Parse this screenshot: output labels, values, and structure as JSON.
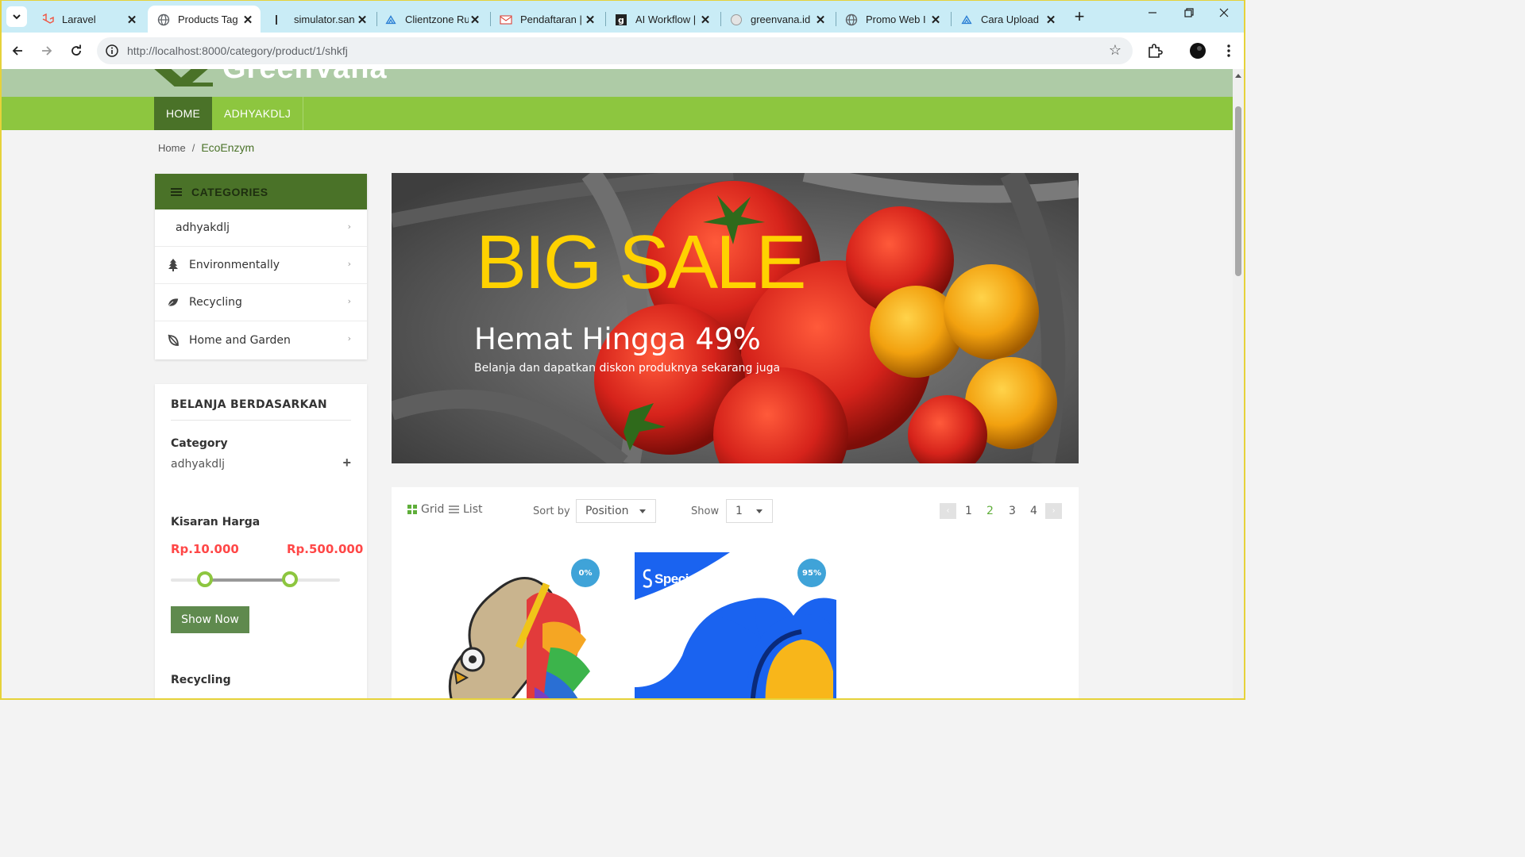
{
  "browser": {
    "tabs": [
      {
        "title": "Laravel",
        "icon": "laravel-icon",
        "active": false
      },
      {
        "title": "Products Tag",
        "icon": "globe-icon",
        "active": true
      },
      {
        "title": "simulator.san",
        "icon": "bar-icon",
        "active": false
      },
      {
        "title": "Clientzone Ru",
        "icon": "cloud-icon",
        "active": false
      },
      {
        "title": "Pendaftaran |",
        "icon": "mail-icon",
        "active": false
      },
      {
        "title": "AI Workflow |",
        "icon": "g-icon",
        "active": false
      },
      {
        "title": "greenvana.id",
        "icon": "globe-icon",
        "active": false
      },
      {
        "title": "Promo Web I",
        "icon": "globe-icon",
        "active": false
      },
      {
        "title": "Cara Upload",
        "icon": "cloud-icon",
        "active": false
      }
    ],
    "url_host": "http://localhost",
    "url_port": ":8000",
    "url_path": "/category/product/1/shkfj"
  },
  "site": {
    "logo_text": "GreenVana",
    "nav": [
      {
        "label": "HOME",
        "active": true
      },
      {
        "label": "ADHYAKDLJ",
        "active": false
      }
    ],
    "breadcrumb": {
      "home": "Home",
      "separator": "/",
      "current": "EcoEnzym"
    }
  },
  "sidebar": {
    "categories_title": "CATEGORIES",
    "categories": [
      {
        "label": "adhyakdlj",
        "icon": ""
      },
      {
        "label": "Environmentally",
        "icon": "tree-icon"
      },
      {
        "label": "Recycling",
        "icon": "leaf-icon"
      },
      {
        "label": "Home and Garden",
        "icon": "leaf-outline-icon"
      }
    ],
    "filter": {
      "title": "BELANJA BERDASARKAN",
      "category_label": "Category",
      "category_value": "adhyakdlj",
      "price_label": "Kisaran Harga",
      "price_min": "Rp.10.000",
      "price_max": "Rp.500.000",
      "show_button": "Show Now",
      "recycling_label": "Recycling"
    }
  },
  "banner": {
    "headline": "BIG SALE",
    "subheadline": "Hemat Hingga 49%",
    "text": "Belanja dan dapatkan diskon produknya sekarang juga"
  },
  "products_toolbar": {
    "grid_label": "Grid",
    "list_label": "List",
    "sort_label": "Sort by",
    "sort_value": "Position",
    "show_label": "Show",
    "show_value": "1",
    "pages": [
      "1",
      "2",
      "3",
      "4"
    ],
    "active_page": "2"
  },
  "products": [
    {
      "badge": "0%",
      "image": "owl-artwork"
    },
    {
      "badge": "95%",
      "image": "special-skill-banner",
      "brand_text": "Special Skill"
    }
  ],
  "colors": {
    "nav_green": "#8dc63f",
    "dark_green": "#4a7228",
    "price_red": "#ff4747",
    "banner_yellow": "#ffd200",
    "badge_blue": "#3fa3d8"
  }
}
